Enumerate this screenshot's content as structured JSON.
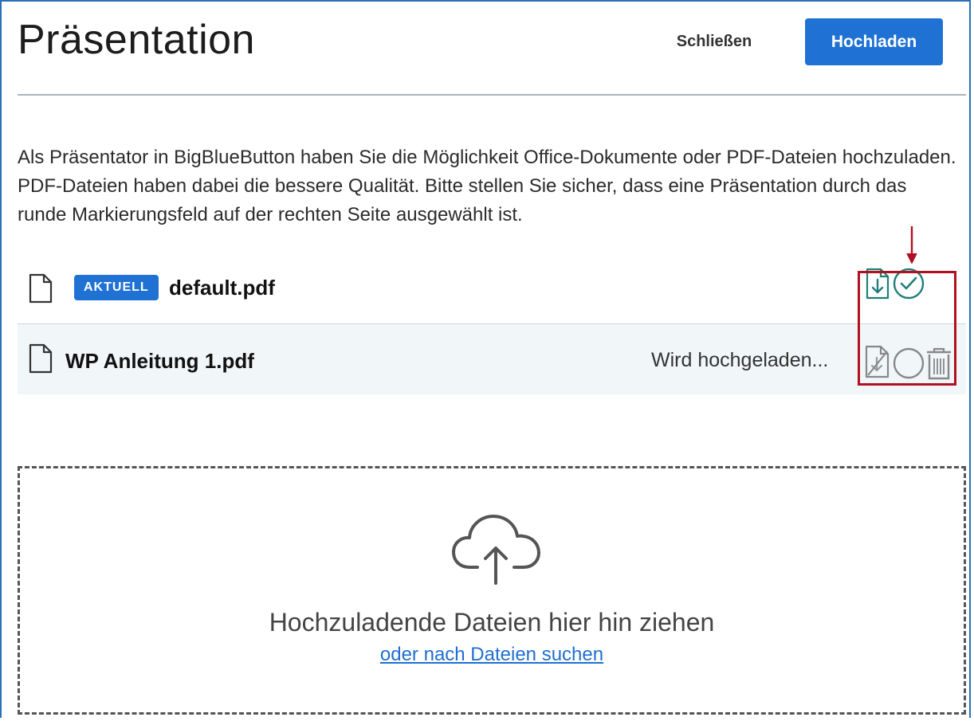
{
  "header": {
    "title": "Präsentation",
    "close_label": "Schließen",
    "upload_label": "Hochladen"
  },
  "description": "Als Präsentator in BigBlueButton haben Sie die Möglichkeit Office-Dokumente oder PDF-Dateien hochzuladen. PDF-Dateien haben dabei die bessere Qualität. Bitte stellen Sie sicher, dass eine Präsentation durch das runde Markierungsfeld auf der rechten Seite ausgewählt ist.",
  "files": [
    {
      "badge": "AKTUELL",
      "name": "default.pdf",
      "status": "",
      "icons": [
        "document-icon",
        "download-file-icon",
        "selected-check-icon"
      ]
    },
    {
      "badge": "",
      "name": "WP Anleitung 1.pdf",
      "status": "Wird hochgeladen...",
      "icons": [
        "document-icon",
        "download-disabled-icon",
        "select-circle-icon",
        "trash-icon"
      ]
    }
  ],
  "dropzone": {
    "text": "Hochzuladende Dateien hier hin ziehen",
    "link": "oder nach Dateien suchen",
    "icon": "cloud-upload-icon"
  },
  "colors": {
    "accent": "#1f72d3",
    "icon_teal": "#1f7f78",
    "annotation_red": "#b01020"
  }
}
